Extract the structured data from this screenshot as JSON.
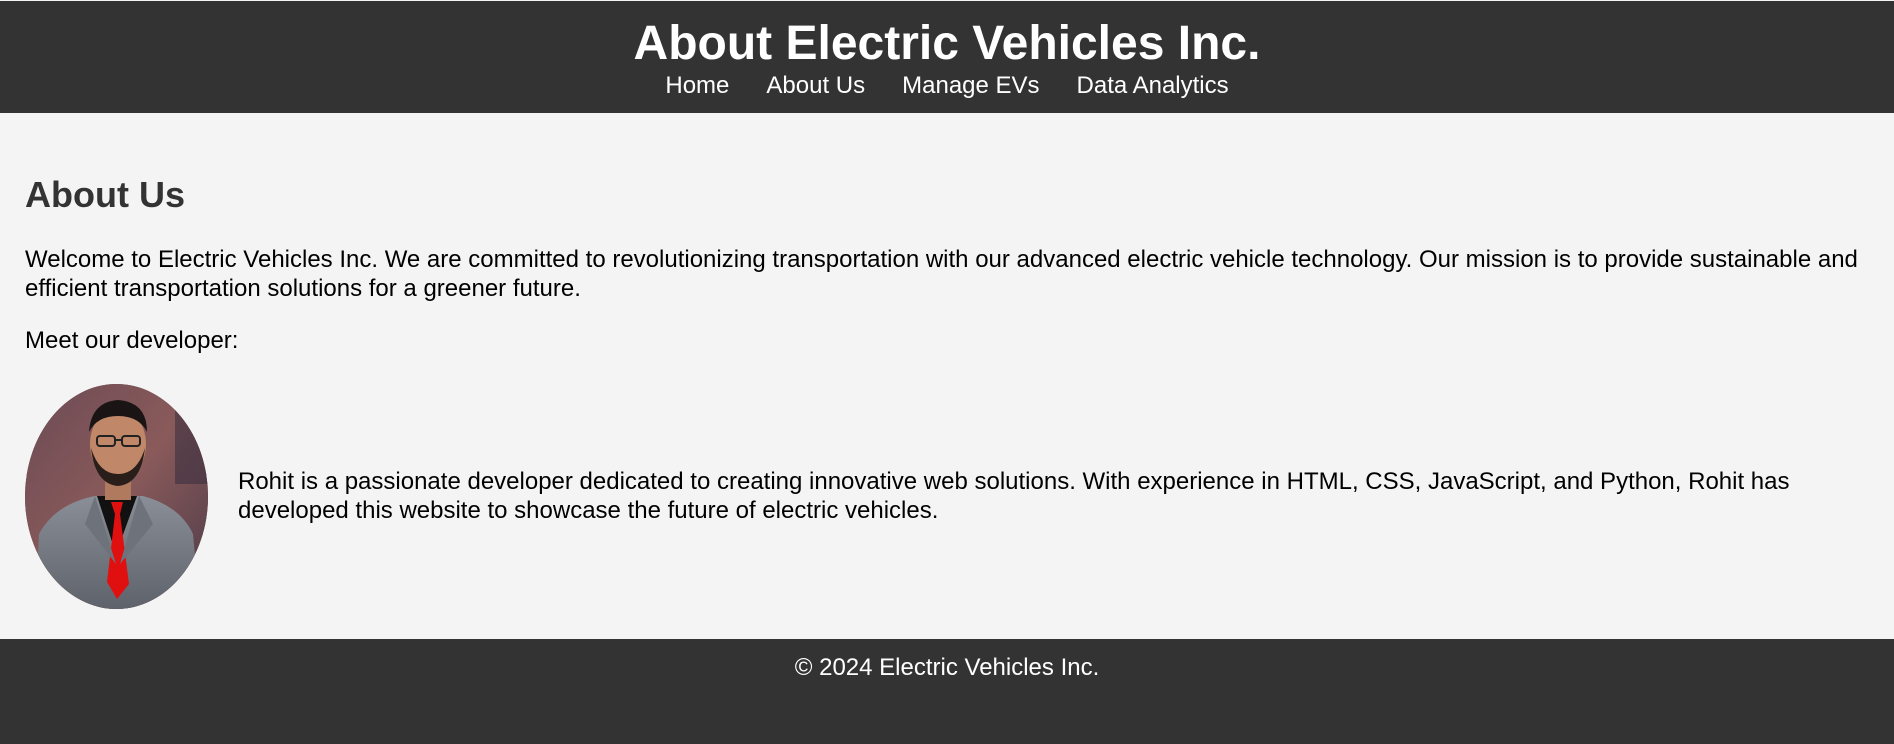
{
  "header": {
    "title": "About Electric Vehicles Inc.",
    "nav": [
      {
        "label": "Home"
      },
      {
        "label": "About Us"
      },
      {
        "label": "Manage EVs"
      },
      {
        "label": "Data Analytics"
      }
    ]
  },
  "main": {
    "heading": "About Us",
    "intro": "Welcome to Electric Vehicles Inc. We are committed to revolutionizing transportation with our advanced electric vehicle technology. Our mission is to provide sustainable and efficient transportation solutions for a greener future.",
    "meet": "Meet our developer:",
    "developer": {
      "photo_icon": "developer-portrait",
      "bio": "Rohit is a passionate developer dedicated to creating innovative web solutions. With experience in HTML, CSS, JavaScript, and Python, Rohit has developed this website to showcase the future of electric vehicles."
    }
  },
  "footer": {
    "text": "© 2024 Electric Vehicles Inc."
  },
  "colors": {
    "header_bg": "#333333",
    "page_bg": "#f4f4f4",
    "tie": "#e01010"
  }
}
